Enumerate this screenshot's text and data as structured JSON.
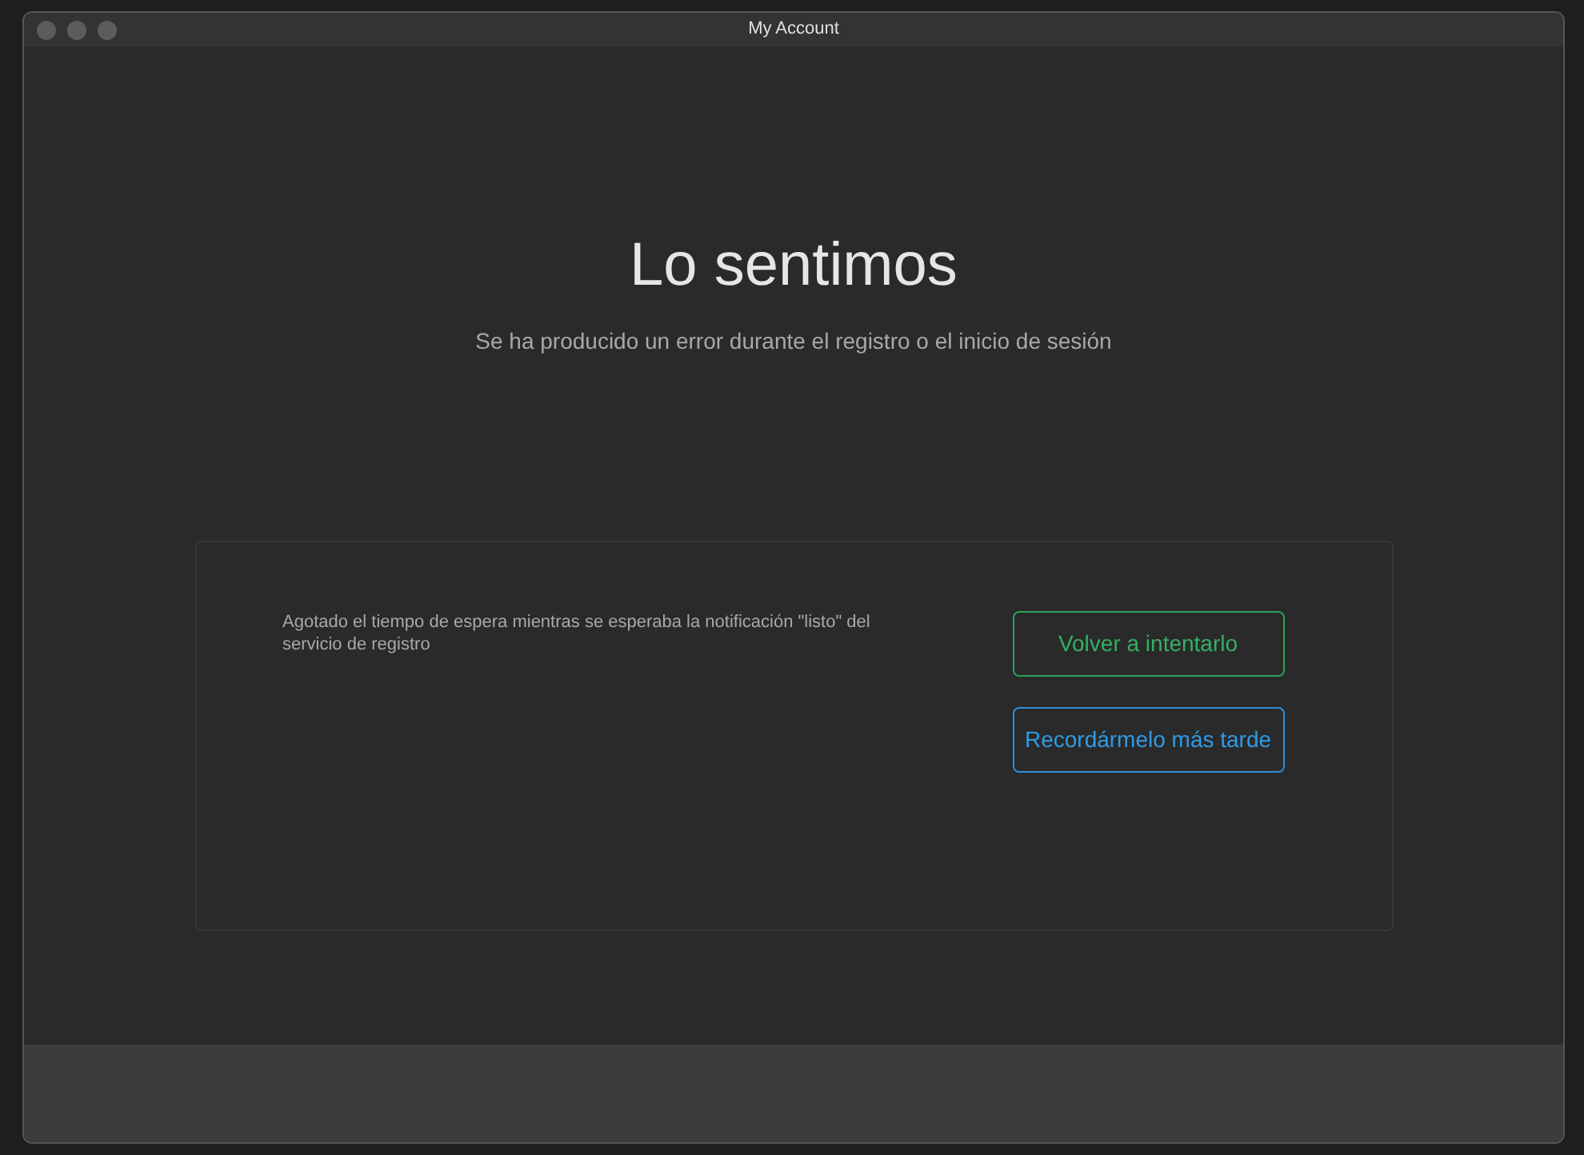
{
  "window": {
    "title": "My Account"
  },
  "heading": "Lo sentimos",
  "subtitle": "Se ha producido un error durante el registro o el inicio de sesión",
  "error_panel": {
    "message": "Agotado el tiempo de espera mientras se esperaba la notificación \"listo\" del servicio de registro",
    "buttons": [
      {
        "label": "Volver a intentarlo",
        "kind": "retry"
      },
      {
        "label": "Recordármelo más tarde",
        "kind": "later"
      }
    ]
  }
}
